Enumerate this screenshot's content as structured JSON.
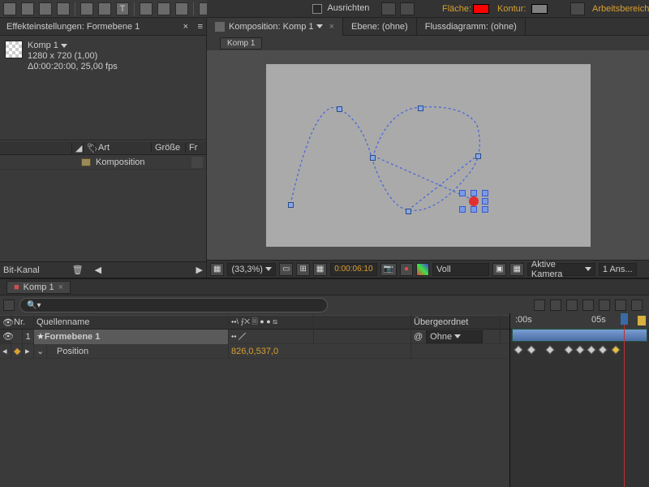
{
  "toolbar": {
    "align_label": "Ausrichten",
    "fill_label": "Fläche:",
    "fill_color": "#ff0000",
    "stroke_label": "Kontur:",
    "stroke_color": "#808080",
    "workspace_label": "Arbeitsbereich:"
  },
  "panel": {
    "title": "Effekteinstellungen: Formebene 1",
    "comp_name": "Komp 1",
    "resolution": "1280 x 720 (1,00)",
    "duration": "Δ0:00:20:00, 25,00 fps"
  },
  "project": {
    "col_type": "Art",
    "col_size": "Größe",
    "col_fr": "Fr",
    "item_name": "Komposition",
    "footer": "Bit-Kanal"
  },
  "viewer": {
    "tab_comp": "Komposition: Komp 1",
    "tab_layer": "Ebene: (ohne)",
    "tab_flow": "Flussdiagramm: (ohne)",
    "crumb": "Komp 1",
    "zoom": "(33,3%)",
    "timecode": "0:00:06:10",
    "res": "Voll",
    "camera": "Aktive Kamera",
    "views": "1 Ans..."
  },
  "timeline": {
    "tab": "Komp 1",
    "search_placeholder": "",
    "col_num": "Nr.",
    "col_name": "Quellenname",
    "col_parent": "Übergeordnet",
    "layer1_num": "1",
    "layer1_name": "Formebene 1",
    "prop_name": "Position",
    "prop_value": "826,0,537,0",
    "parent_value": "Ohne",
    "ruler_0": ":00s",
    "ruler_5": "05s"
  }
}
